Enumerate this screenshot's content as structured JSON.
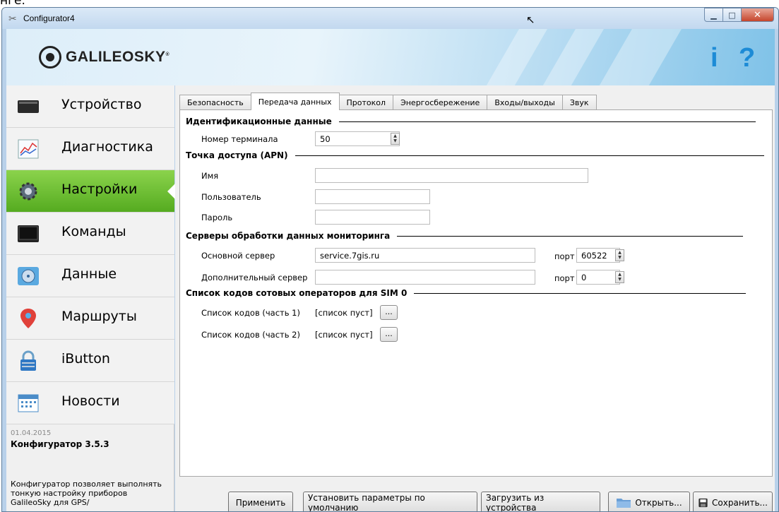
{
  "clipped_text": "нге.",
  "window": {
    "title": "Configurator4",
    "controls": {
      "minimize": "▁",
      "maximize": "□",
      "close": "✕"
    }
  },
  "header": {
    "logo": "GALILEOSKY",
    "logo_mark": "®",
    "info_label": "i",
    "help_label": "?"
  },
  "sidebar": {
    "items": [
      {
        "label": "Устройство",
        "icon": "device-icon"
      },
      {
        "label": "Диагностика",
        "icon": "chart-icon"
      },
      {
        "label": "Настройки",
        "icon": "gear-icon",
        "active": true
      },
      {
        "label": "Команды",
        "icon": "terminal-icon"
      },
      {
        "label": "Данные",
        "icon": "disk-icon"
      },
      {
        "label": "Маршруты",
        "icon": "map-pin-icon"
      },
      {
        "label": "iButton",
        "icon": "lock-icon"
      },
      {
        "label": "Новости",
        "icon": "calendar-icon"
      }
    ],
    "news": {
      "date": "01.04.2015",
      "title": "Конфигуратор 3.5.3",
      "text": "Конфигуратор позволяет выполнять тонкую настройку приборов GalileoSky для GPS/"
    }
  },
  "tabs": [
    {
      "label": "Безопасность"
    },
    {
      "label": "Передача данных",
      "active": true
    },
    {
      "label": "Протокол"
    },
    {
      "label": "Энергосбережение"
    },
    {
      "label": "Входы/выходы"
    },
    {
      "label": "Звук"
    }
  ],
  "sections": {
    "ident": {
      "title": "Идентификационные данные",
      "terminal_label": "Номер терминала",
      "terminal_value": "50"
    },
    "apn": {
      "title": "Точка доступа (APN)",
      "name_label": "Имя",
      "name_value": "",
      "user_label": "Пользователь",
      "user_value": "",
      "pass_label": "Пароль",
      "pass_value": ""
    },
    "servers": {
      "title": "Серверы обработки данных мониторинга",
      "main_label": "Основной сервер",
      "main_value": "service.7gis.ru",
      "main_port_label": "порт",
      "main_port_value": "60522",
      "extra_label": "Дополнительный сервер",
      "extra_value": "",
      "extra_port_label": "порт",
      "extra_port_value": "0"
    },
    "codes": {
      "title": "Список кодов сотовых операторов для SIM 0",
      "part1_label": "Список кодов (часть 1)",
      "part1_value": "[список пуст]",
      "part2_label": "Список кодов (часть 2)",
      "part2_value": "[список пуст]",
      "dots": "..."
    }
  },
  "buttons": {
    "apply": "Применить",
    "defaults": "Установить параметры по умолчанию",
    "load": "Загрузить из устройства",
    "open": "Открыть...",
    "save": "Сохранить..."
  },
  "colors": {
    "active_nav": "#6cc132",
    "brand_blue": "#1d8bd6",
    "window_frame": "#b9d1ea"
  }
}
